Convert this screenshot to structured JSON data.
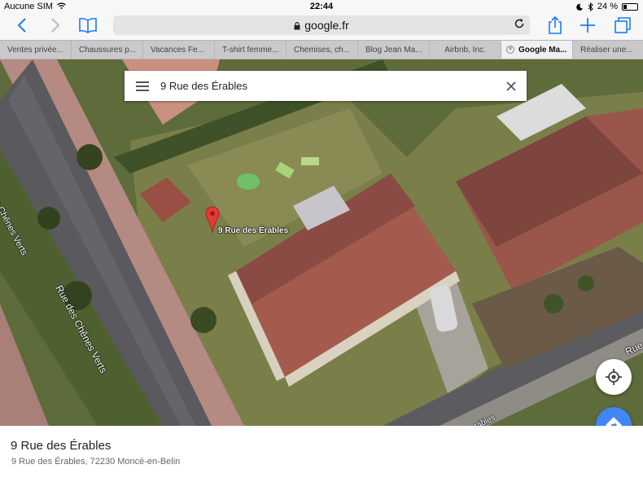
{
  "status_bar": {
    "carrier": "Aucune SIM",
    "time": "22:44",
    "battery": "24 %",
    "battery_level": 0.24
  },
  "browser": {
    "url": "google.fr",
    "tabs": [
      {
        "label": "Ventes privée..."
      },
      {
        "label": "Chaussures p..."
      },
      {
        "label": "Vacances Fe..."
      },
      {
        "label": "T-shirt femme..."
      },
      {
        "label": "Chemises, ch..."
      },
      {
        "label": "Blog Jean Ma..."
      },
      {
        "label": "Airbnb, Inc."
      },
      {
        "label": "Google Ma...",
        "active": true
      },
      {
        "label": "Réaliser une..."
      }
    ]
  },
  "map": {
    "search_query": "9 Rue des Érables",
    "pin_label": "9 Rue des Érables",
    "road_labels": {
      "road_top": "Rue des Chênes Verts",
      "road_mid": "Rue des Chênes Verts",
      "road_bottom_frag": "Rue",
      "street_bottom_frag": "rables"
    },
    "accent_color": "#4285f4",
    "pin_color": "#e53935"
  },
  "place": {
    "title": "9 Rue des Érables",
    "address": "9 Rue des Érables, 72230 Moncé-en-Belin"
  }
}
